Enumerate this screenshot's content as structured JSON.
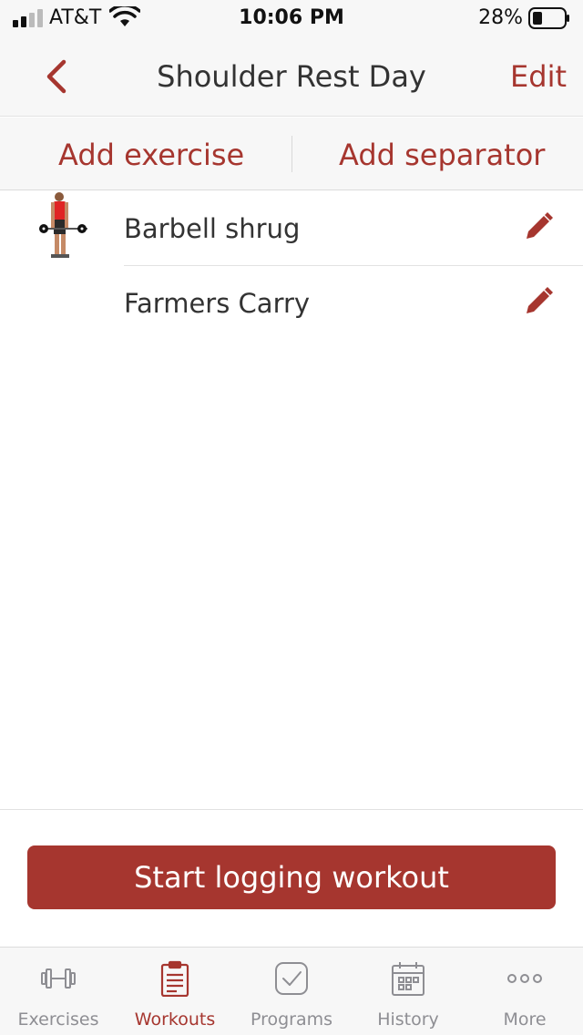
{
  "status_bar": {
    "carrier": "AT&T",
    "time": "10:06 PM",
    "battery": "28%"
  },
  "nav": {
    "title": "Shoulder Rest Day",
    "edit_label": "Edit"
  },
  "actions": {
    "add_exercise": "Add exercise",
    "add_separator": "Add separator"
  },
  "exercises": [
    {
      "name": "Barbell shrug",
      "has_thumbnail": true
    },
    {
      "name": "Farmers Carry",
      "has_thumbnail": false
    }
  ],
  "start_button": "Start logging workout",
  "tabs": [
    {
      "label": "Exercises",
      "icon": "dumbbell-icon",
      "active": false
    },
    {
      "label": "Workouts",
      "icon": "clipboard-icon",
      "active": true
    },
    {
      "label": "Programs",
      "icon": "checkbox-icon",
      "active": false
    },
    {
      "label": "History",
      "icon": "calendar-icon",
      "active": false
    },
    {
      "label": "More",
      "icon": "more-dots-icon",
      "active": false
    }
  ],
  "colors": {
    "accent": "#a6362f",
    "inactive": "#8e8e93"
  }
}
